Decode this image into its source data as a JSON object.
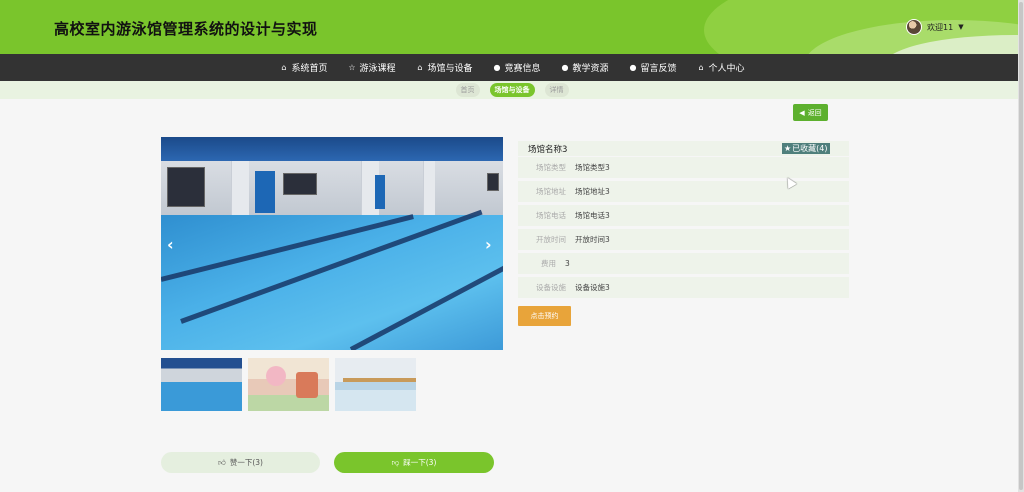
{
  "site": {
    "title": "高校室内游泳馆管理系统的设计与实现"
  },
  "user": {
    "welcome": "欢迎11"
  },
  "nav": [
    {
      "icon": "home-icon",
      "label": "系统首页"
    },
    {
      "icon": "star-icon",
      "label": "游泳课程"
    },
    {
      "icon": "building-icon",
      "label": "场馆与设备"
    },
    {
      "icon": "info-icon",
      "label": "竞赛信息"
    },
    {
      "icon": "info-icon",
      "label": "教学资源"
    },
    {
      "icon": "info-icon",
      "label": "留言反馈"
    },
    {
      "icon": "home-icon",
      "label": "个人中心"
    }
  ],
  "breadcrumb": [
    "首页",
    "场馆与设备",
    "详情"
  ],
  "back_label": "返回",
  "detail": {
    "name": "场馆名称3",
    "favorite_label": "已收藏(4)",
    "fields": [
      {
        "label": "场馆类型",
        "value": "场馆类型3"
      },
      {
        "label": "场馆地址",
        "value": "场馆地址3"
      },
      {
        "label": "场馆电话",
        "value": "场馆电话3"
      },
      {
        "label": "开放时间",
        "value": "开放时间3"
      },
      {
        "label": "费用",
        "value": "3"
      },
      {
        "label": "设备设施",
        "value": "设备设施3"
      }
    ],
    "reserve_label": "点击预约"
  },
  "actions": {
    "like_label": "赞一下(3)",
    "dislike_label": "踩一下(3)"
  },
  "colors": {
    "brand_green": "#7ac52c",
    "nav_bg": "#333333",
    "reserve_orange": "#e8a43a"
  }
}
